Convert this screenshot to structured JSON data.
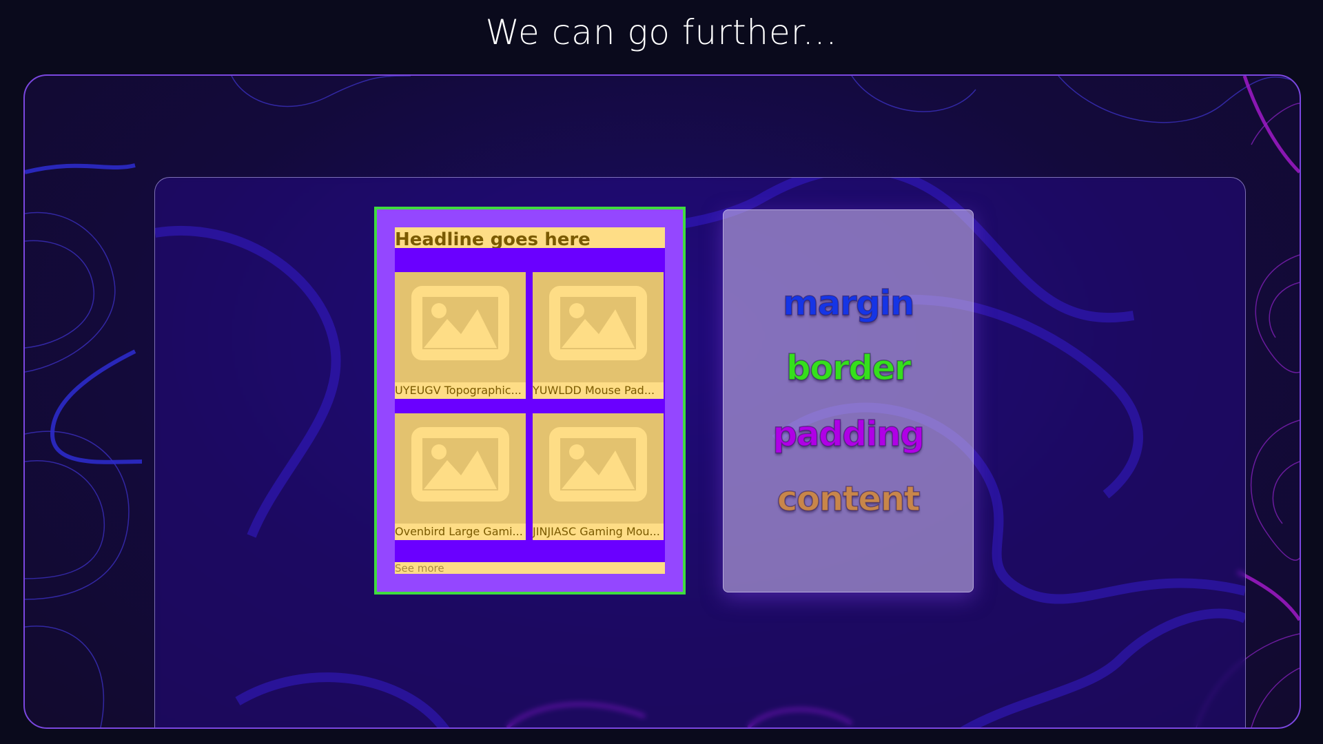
{
  "page": {
    "title": "We can go further..."
  },
  "card": {
    "headline": "Headline goes here",
    "products": [
      {
        "label": "UYEUGV Topographic..."
      },
      {
        "label": "YUWLDD Mouse Pad..."
      },
      {
        "label": "Ovenbird Large Gami..."
      },
      {
        "label": "JINJIASC Gaming Mou..."
      }
    ],
    "see_more": "See more",
    "image_icon": "image-placeholder-icon"
  },
  "legend": {
    "items": [
      {
        "label": "margin",
        "color": "#1535e6"
      },
      {
        "label": "border",
        "color": "#35e01c"
      },
      {
        "label": "padding",
        "color": "#b000e6"
      },
      {
        "label": "content",
        "color": "#c8864a"
      }
    ]
  },
  "colors": {
    "margin": "#9447ff",
    "border": "#3fdc3f",
    "padding": "#6a00ff",
    "content": "#fedd86"
  }
}
